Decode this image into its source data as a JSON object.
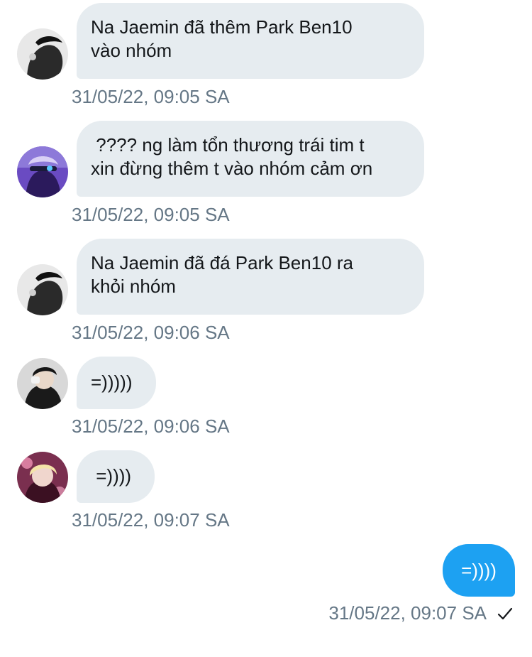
{
  "messages": [
    {
      "avatar_icon": "user-avatar-icon",
      "text": "Na Jaemin đã thêm Park Ben10\nvào nhóm",
      "time": "31/05/22, 09:05 SA"
    },
    {
      "avatar_icon": "user-avatar-icon",
      "text": " ???? ng làm tổn thương trái tim t\nxin đừng thêm t vào nhóm cảm ơn",
      "time": "31/05/22, 09:05 SA"
    },
    {
      "avatar_icon": "user-avatar-icon",
      "text": "Na Jaemin đã đá Park Ben10 ra\nkhỏi nhóm",
      "time": "31/05/22, 09:06 SA"
    },
    {
      "avatar_icon": "user-avatar-icon",
      "text": "=)))))",
      "time": "31/05/22, 09:06 SA"
    },
    {
      "avatar_icon": "user-avatar-icon",
      "text": " =))))",
      "time": "31/05/22, 09:07 SA"
    }
  ],
  "outgoing": {
    "text": "=))))",
    "time": "31/05/22, 09:07 SA",
    "status_icon": "checkmark-icon"
  },
  "colors": {
    "incoming_bubble": "#e6ecf0",
    "outgoing_bubble": "#1da1f2",
    "timestamp": "#657786"
  }
}
